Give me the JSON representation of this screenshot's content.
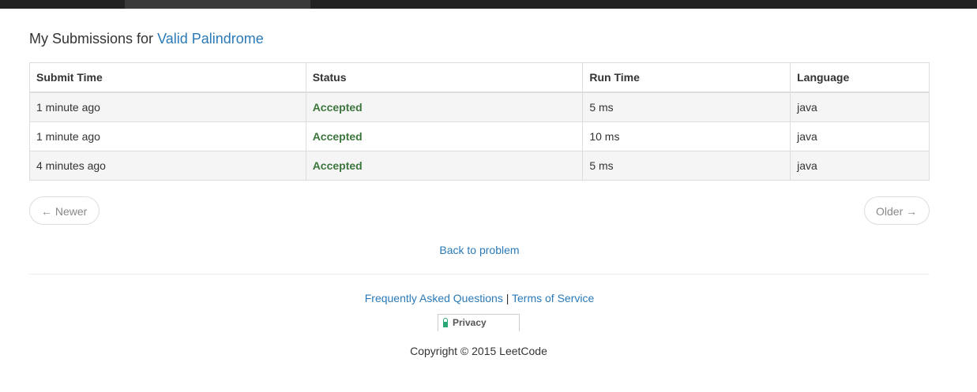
{
  "page": {
    "heading_prefix": "My Submissions for",
    "problem_name": "Valid Palindrome"
  },
  "table": {
    "headers": [
      "Submit Time",
      "Status",
      "Run Time",
      "Language"
    ],
    "rows": [
      {
        "submit_time": "1 minute ago",
        "status": "Accepted",
        "run_time": "5 ms",
        "language": "java"
      },
      {
        "submit_time": "1 minute ago",
        "status": "Accepted",
        "run_time": "10 ms",
        "language": "java"
      },
      {
        "submit_time": "4 minutes ago",
        "status": "Accepted",
        "run_time": "5 ms",
        "language": "java"
      }
    ]
  },
  "pager": {
    "newer_label": "← Newer",
    "older_label": "Older →"
  },
  "back_link": "Back to problem",
  "footer": {
    "faq_label": "Frequently Asked Questions",
    "separator": "|",
    "tos_label": "Terms of Service",
    "privacy_label": "Privacy",
    "privacy_icon": "lock-icon",
    "copyright": "Copyright © 2015 LeetCode"
  },
  "colors": {
    "link": "#2a7ab8",
    "accepted": "#3c763d",
    "topbar": "#222222"
  }
}
